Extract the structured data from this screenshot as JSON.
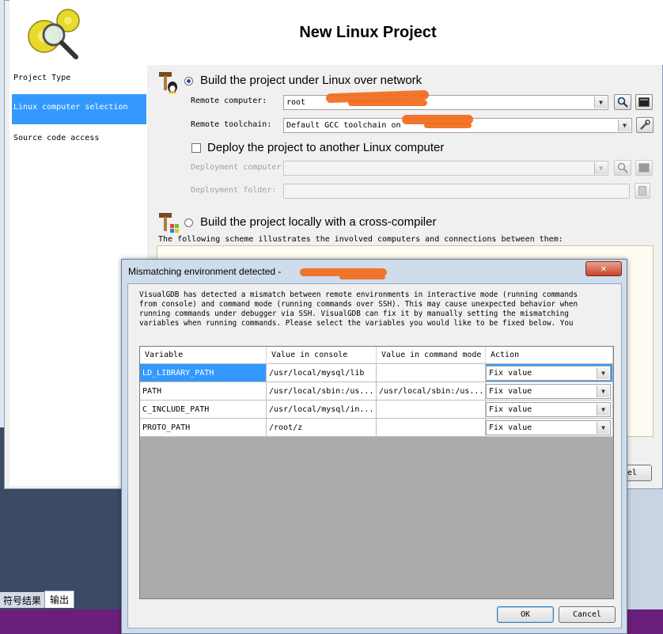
{
  "background": {
    "bottom_tabs": [
      "符号结果",
      "输出"
    ],
    "partial_button": "el"
  },
  "wizard": {
    "title": "New Linux Project",
    "nav": [
      "Project Type",
      "Linux computer selection",
      "Source code access"
    ],
    "build_remote_label": "Build the project under Linux over network",
    "remote_computer_label": "Remote computer:",
    "remote_computer_value": "root",
    "remote_toolchain_label": "Remote toolchain:",
    "remote_toolchain_value": "Default GCC toolchain on",
    "deploy_label": "Deploy the project to another Linux computer",
    "deployment_computer_label": "Deployment computer:",
    "deployment_folder_label": "Deployment folder:",
    "build_local_label": "Build the project locally with a cross-compiler",
    "scheme_text": "The following scheme illustrates the involved computers and connections between them:"
  },
  "dialog": {
    "title": "Mismatching environment detected - ",
    "close_glyph": "✕",
    "description": "VisualGDB has detected a mismatch between remote environments in interactive mode (running commands\nfrom console) and command mode (running commands over SSH). This may cause unexpected behavior when\nrunning commands under debugger via SSH. VisualGDB can fix it by manually setting the mismatching\nvariables when running commands. Please select the variables you would like to be fixed below. You",
    "columns": [
      "Variable",
      "Value in console",
      "Value in command mode",
      "Action"
    ],
    "rows": [
      {
        "variable": "LD_LIBRARY_PATH",
        "console": "/usr/local/mysql/lib",
        "command": "",
        "action": "Fix value"
      },
      {
        "variable": "PATH",
        "console": "/usr/local/sbin:/us...",
        "command": "/usr/local/sbin:/us...",
        "action": "Fix value"
      },
      {
        "variable": "C_INCLUDE_PATH",
        "console": "/usr/local/mysql/in...",
        "command": "",
        "action": "Fix value"
      },
      {
        "variable": "PROTO_PATH",
        "console": "/root/z",
        "command": "",
        "action": "Fix value"
      }
    ],
    "ok_label": "OK",
    "cancel_label": "Cancel"
  },
  "icons": {
    "logo": "gears-magnifier-icon",
    "build_tools": "hammer-wrench-linux-icon",
    "build_tools_local": "hammer-windows-icon",
    "search": "magnifier-icon",
    "terminal": "terminal-icon",
    "settings": "wrench-icon",
    "browse": "folder-icon",
    "dropdown": "chevron-down-icon"
  },
  "colors": {
    "selection": "#3399ff",
    "redaction": "#f26a1b",
    "dialog_frame": "#cfdcec"
  }
}
